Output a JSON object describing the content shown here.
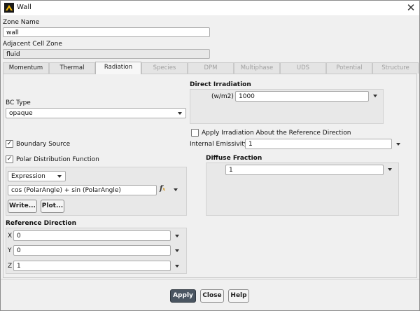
{
  "window": {
    "title": "Wall"
  },
  "zone_name": {
    "label": "Zone Name",
    "value": "wall"
  },
  "adjacent_cell_zone": {
    "label": "Adjacent Cell Zone",
    "value": "fluid"
  },
  "tabs": [
    {
      "label": "Momentum",
      "state": "normal"
    },
    {
      "label": "Thermal",
      "state": "normal"
    },
    {
      "label": "Radiation",
      "state": "active"
    },
    {
      "label": "Species",
      "state": "disabled"
    },
    {
      "label": "DPM",
      "state": "disabled"
    },
    {
      "label": "Multiphase",
      "state": "disabled"
    },
    {
      "label": "UDS",
      "state": "disabled"
    },
    {
      "label": "Potential",
      "state": "normal"
    },
    {
      "label": "Structure",
      "state": "disabled"
    }
  ],
  "radiation": {
    "bc_type": {
      "label": "BC Type",
      "value": "opaque"
    },
    "boundary_source": {
      "label": "Boundary Source",
      "checked": true
    },
    "polar_distribution": {
      "label": "Polar Distribution Function",
      "checked": true
    },
    "expression": {
      "mode": "Expression",
      "value": "cos (PolarAngle) + sin (PolarAngle)",
      "fx_icon": "function-icon",
      "write_label": "Write...",
      "plot_label": "Plot..."
    },
    "reference_direction": {
      "title": "Reference Direction",
      "x": {
        "label": "X",
        "value": "0"
      },
      "y": {
        "label": "Y",
        "value": "0"
      },
      "z": {
        "label": "Z",
        "value": "1"
      }
    },
    "direct_irradiation": {
      "title": "Direct Irradiation",
      "unit": "(w/m2)",
      "value": "1000"
    },
    "apply_irradiation_ref": {
      "label": "Apply Irradiation About the Reference Direction",
      "checked": false
    },
    "internal_emissivity": {
      "label": "Internal Emissivity",
      "value": "1"
    },
    "diffuse_fraction": {
      "title": "Diffuse Fraction",
      "value": "1"
    }
  },
  "footer": {
    "apply": "Apply",
    "close": "Close",
    "help": "Help"
  }
}
